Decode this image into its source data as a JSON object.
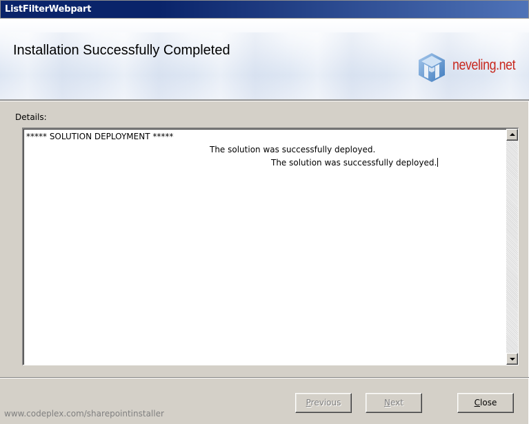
{
  "window": {
    "title": "ListFilterWebpart"
  },
  "header": {
    "title": "Installation Successfully Completed",
    "logo_text": "neveling.net",
    "logo_icon": "neveling-cube-icon"
  },
  "details": {
    "label": "Details:",
    "lines": [
      "***** SOLUTION DEPLOYMENT *****",
      "The solution was successfully deployed.",
      "The solution was successfully deployed."
    ]
  },
  "buttons": {
    "previous": {
      "accel": "P",
      "rest": "revious",
      "enabled": false
    },
    "next": {
      "accel": "N",
      "rest": "ext",
      "enabled": false
    },
    "close": {
      "accel": "C",
      "rest": "lose",
      "enabled": true
    }
  },
  "footer": {
    "link_text": "www.codeplex.com/sharepointinstaller"
  },
  "colors": {
    "titlebar": "#0a246a",
    "logo_text": "#c8281e",
    "dialog_bg": "#d4d0c8"
  }
}
